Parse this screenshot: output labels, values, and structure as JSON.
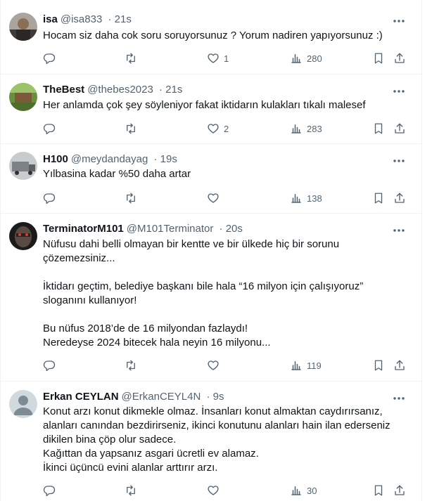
{
  "tweets": [
    {
      "name": "isa",
      "handle": "@isa833",
      "time": "21s",
      "text": "Hocam siz daha cok soru soruyorsunuz ? Yorum nadiren yapıyorsunuz :)",
      "likes": "1",
      "views": "280"
    },
    {
      "name": "TheBest",
      "handle": "@thebes2023",
      "time": "21s",
      "text": "Her anlamda çok şey söyleniyor fakat iktidarın kulakları tıkalı malesef",
      "likes": "2",
      "views": "283"
    },
    {
      "name": "H100",
      "handle": "@meydandayag",
      "time": "19s",
      "text": "Yılbasina kadar %50 daha artar",
      "likes": "",
      "views": "138"
    },
    {
      "name": "TerminatorM101",
      "handle": "@M101Terminator",
      "time": "20s",
      "text": "Nüfusu dahi belli olmayan bir kentte ve bir ülkede hiç bir sorunu\nçözemezsiniz...\n\nİktidarı geçtim, belediye başkanı bile hala “16 milyon için çalışıyoruz”\nsloganını kullanıyor!\n\nBu nüfus 2018’de de 16 milyondan fazlaydı!\nNeredeyse 2024 bitecek hala neyin 16 milyonu...",
      "likes": "",
      "views": "119"
    },
    {
      "name": "Erkan CEYLAN",
      "handle": "@ErkanCEYL4N",
      "time": "9s",
      "text": "Konut arzı konut dikmekle olmaz. İnsanları konut almaktan caydırırsanız,\nalanları canından bezdirirseniz, ikinci konutunu alanları hain ilan ederseniz\ndikilen bina çöp olur sadece.\nKağıttan da yapsanız asgari ücretli ev alamaz.\nİkinci üçüncü evini alanlar arttırır arzı.",
      "likes": "",
      "views": "30"
    }
  ],
  "icons": {
    "reply": "reply-icon",
    "retweet": "retweet-icon",
    "like": "heart-icon",
    "views": "views-icon",
    "bookmark": "bookmark-icon",
    "share": "share-icon",
    "more": "more-icon"
  },
  "colors": {
    "text": "#0f1419",
    "secondary": "#536471",
    "divider": "#eff3f4"
  }
}
